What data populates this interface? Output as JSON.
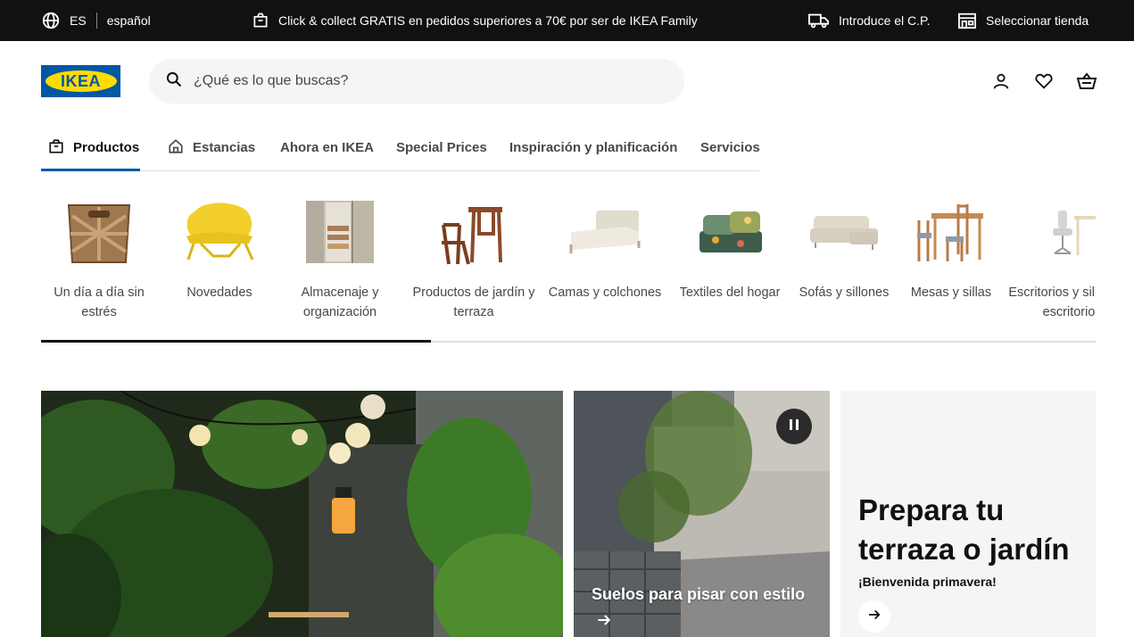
{
  "topbar": {
    "lang_code": "ES",
    "lang_name": "español",
    "promo": "Click & collect GRATIS en pedidos superiores a 70€ por ser de IKEA Family",
    "postcode": "Introduce el C.P.",
    "store": "Seleccionar tienda"
  },
  "header": {
    "logo_text": "IKEA",
    "search_placeholder": "¿Qué es lo que buscas?"
  },
  "nav": {
    "tabs": [
      {
        "label": "Productos",
        "active": true
      },
      {
        "label": "Estancias"
      },
      {
        "label": "Ahora en IKEA"
      },
      {
        "label": "Special Prices"
      },
      {
        "label": "Inspiración y planificación"
      },
      {
        "label": "Servicios"
      }
    ]
  },
  "categories": [
    {
      "label": "Un día a día sin estrés",
      "icon": "basket-icon"
    },
    {
      "label": "Novedades",
      "icon": "lounge-chair-icon"
    },
    {
      "label": "Almacenaje y organización",
      "icon": "wardrobe-icon"
    },
    {
      "label": "Productos de jardín y terraza",
      "icon": "garden-furniture-icon"
    },
    {
      "label": "Camas y colchones",
      "icon": "bed-icon"
    },
    {
      "label": "Textiles del hogar",
      "icon": "textiles-icon"
    },
    {
      "label": "Sofás y sillones",
      "icon": "sofa-icon"
    },
    {
      "label": "Mesas y sillas",
      "icon": "dining-set-icon"
    },
    {
      "label": "Escritorios y sillas de escritorio",
      "icon": "desk-icon"
    }
  ],
  "carousel": {
    "progress": 0.37
  },
  "hero": {
    "second_caption": "Suelos para pisar con estilo",
    "promo_title": "Prepara tu terraza o jardín",
    "promo_subtitle": "¡Bienvenida primavera!"
  },
  "colors": {
    "brand_blue": "#0058a3",
    "brand_yellow": "#ffdb00",
    "topbar_bg": "#111111"
  }
}
